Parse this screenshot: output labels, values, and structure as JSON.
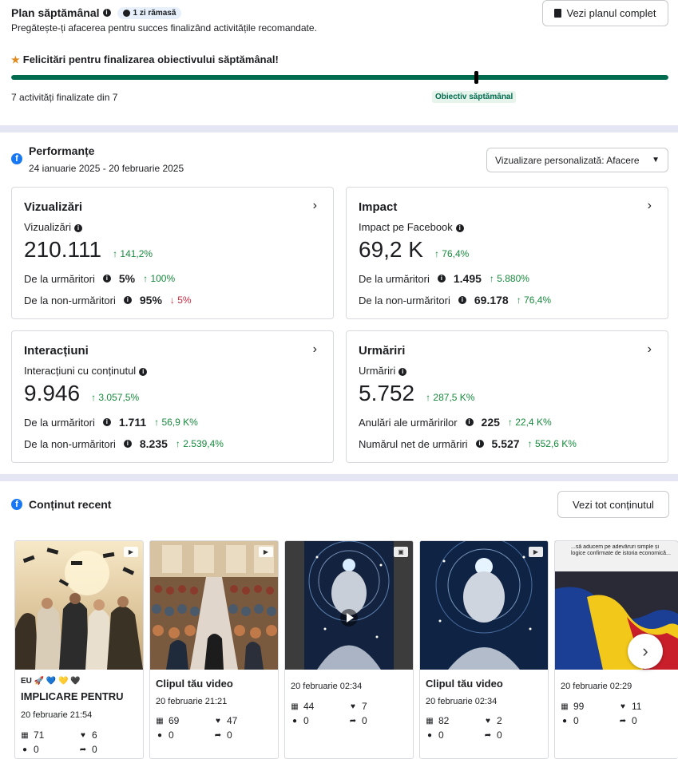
{
  "weekly_plan": {
    "title": "Plan săptămânal",
    "time_badge": "1 zi rămasă",
    "subtitle": "Pregătește-ți afacerea pentru succes finalizând activitățile recomandate.",
    "button_label": "Vezi planul complet",
    "congrats": "Felicitări pentru finalizarea obiectivului săptămânal!",
    "progress_fraction": 1.0,
    "progress_text": "7 activități finalizate din 7",
    "goal_label": "Obiectiv săptămânal"
  },
  "performance": {
    "title": "Performanțe",
    "date_range": "24 ianuarie 2025 - 20 februarie 2025",
    "view_select": "Vizualizare personalizată: Afacere",
    "cards": {
      "views": {
        "title": "Vizualizări",
        "metric_label": "Vizualizări",
        "value": "210.111",
        "delta": "141,2%",
        "row1_label": "De la urmăritori",
        "row1_value": "5%",
        "row1_delta": "100%",
        "row2_label": "De la non-urmăritori",
        "row2_value": "95%",
        "row2_delta": "5%"
      },
      "impact": {
        "title": "Impact",
        "metric_label": "Impact pe Facebook",
        "value": "69,2 K",
        "delta": "76,4%",
        "row1_label": "De la urmăritori",
        "row1_value": "1.495",
        "row1_delta": "5.880%",
        "row2_label": "De la non-urmăritori",
        "row2_value": "69.178",
        "row2_delta": "76,4%"
      },
      "interactions": {
        "title": "Interacțiuni",
        "metric_label": "Interacțiuni cu conținutul",
        "value": "9.946",
        "delta": "3.057,5%",
        "row1_label": "De la urmăritori",
        "row1_value": "1.711",
        "row1_delta": "56,9 K%",
        "row2_label": "De la non-urmăritori",
        "row2_value": "8.235",
        "row2_delta": "2.539,4%"
      },
      "follows": {
        "title": "Urmăriri",
        "metric_label": "Urmăriri",
        "value": "5.752",
        "delta": "287,5 K%",
        "row1_label": "Anulări ale urmăririlor",
        "row1_value": "225",
        "row1_delta": "22,4 K%",
        "row2_label": "Numărul net de urmăriri",
        "row2_value": "5.527",
        "row2_delta": "552,6 K%"
      }
    }
  },
  "recent": {
    "title": "Conținut recent",
    "button_label": "Vezi tot conținutul",
    "tiles": [
      {
        "emoji": "EU 🚀 💙 💛 🖤",
        "caption": "IMPLICARE PENTRU",
        "date": "20 februarie 21:54",
        "views": "71",
        "likes": "6",
        "comments": "0",
        "shares": "0"
      },
      {
        "caption": "Clipul tău video",
        "date": "20 februarie 21:21",
        "views": "69",
        "likes": "47",
        "comments": "0",
        "shares": "0"
      },
      {
        "date": "20 februarie 02:34",
        "views": "44",
        "likes": "7",
        "comments": "0",
        "shares": "0"
      },
      {
        "caption": "Clipul tău video",
        "date": "20 februarie 02:34",
        "views": "82",
        "likes": "2",
        "comments": "0",
        "shares": "0"
      },
      {
        "overlay_text": "...să aducem pe adevăruri simple și logice confirmate de istoria economică...",
        "date": "20 februarie 02:29",
        "views": "99",
        "likes": "11",
        "comments": "0",
        "shares": "0"
      }
    ]
  },
  "colors": {
    "accent_green": "#006b4f",
    "up_green": "#168a3c",
    "down_red": "#c8283e",
    "facebook_blue": "#1877f2"
  }
}
